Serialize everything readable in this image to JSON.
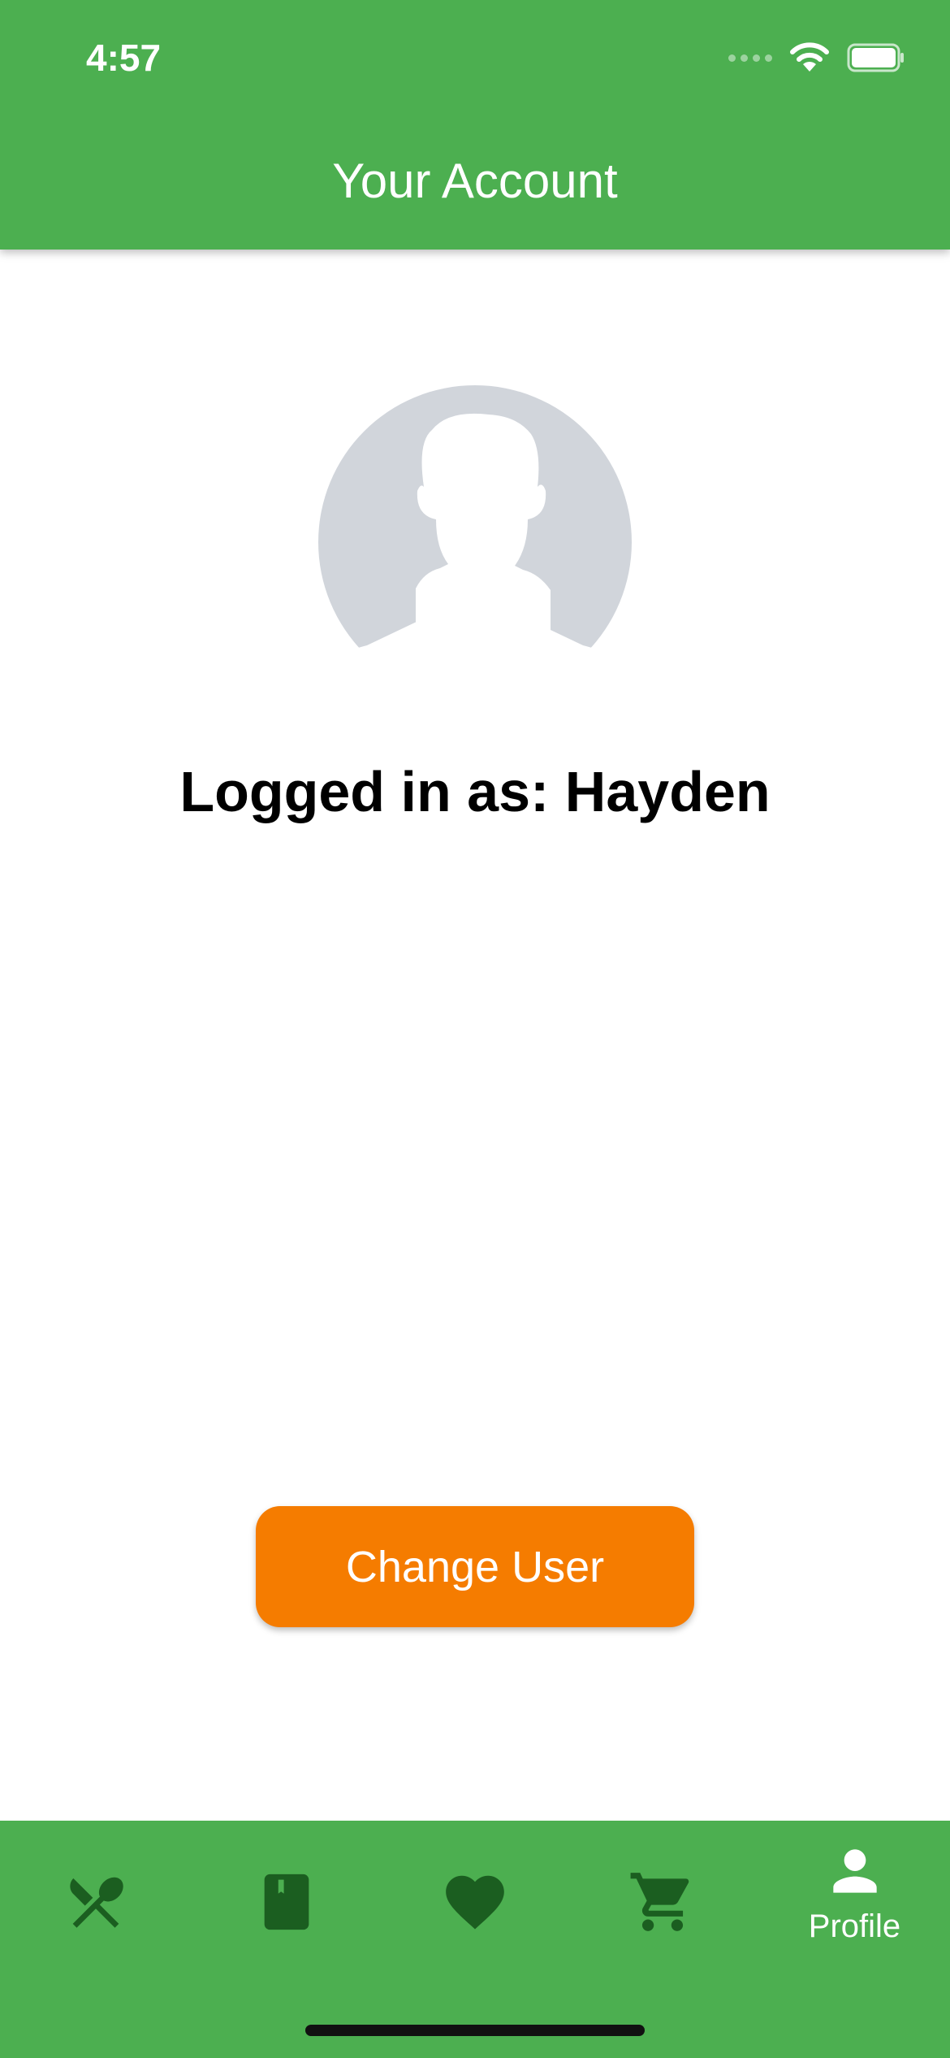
{
  "status_bar": {
    "time": "4:57"
  },
  "header": {
    "title": "Your Account",
    "background_color": "#4CAF50"
  },
  "profile": {
    "logged_in_text": "Logged in as: Hayden",
    "avatar_icon": "default-user-silhouette"
  },
  "actions": {
    "change_user_label": "Change User",
    "button_color": "#F57C00"
  },
  "bottom_nav": {
    "background_color": "#4CAF50",
    "active_index": 4,
    "items": [
      {
        "icon": "fork-spoon-icon",
        "label": ""
      },
      {
        "icon": "book-icon",
        "label": ""
      },
      {
        "icon": "heart-icon",
        "label": ""
      },
      {
        "icon": "cart-icon",
        "label": ""
      },
      {
        "icon": "person-icon",
        "label": "Profile"
      }
    ]
  }
}
